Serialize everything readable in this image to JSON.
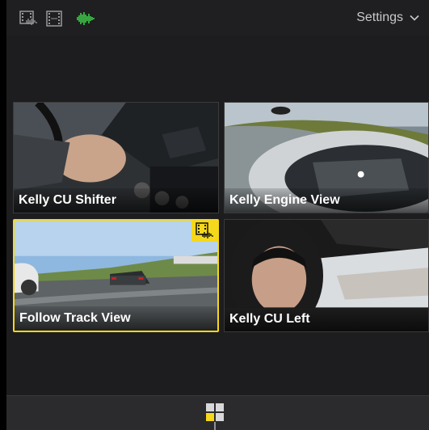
{
  "toolbar": {
    "icons": [
      "video-audio-switch-icon",
      "video-only-switch-icon",
      "audio-only-switch-icon"
    ],
    "settings_label": "Settings",
    "accent_green": "#3ec948"
  },
  "angles": [
    {
      "label": "Kelly CU Shifter",
      "active": false
    },
    {
      "label": "Kelly Engine View",
      "active": false
    },
    {
      "label": "Follow Track View",
      "active": true
    },
    {
      "label": "Kelly CU Left",
      "active": false
    }
  ],
  "colors": {
    "active_angle": "#f5d81c",
    "background": "#1d1d1f"
  },
  "bottom": {
    "icon": "angle-grid-icon"
  }
}
